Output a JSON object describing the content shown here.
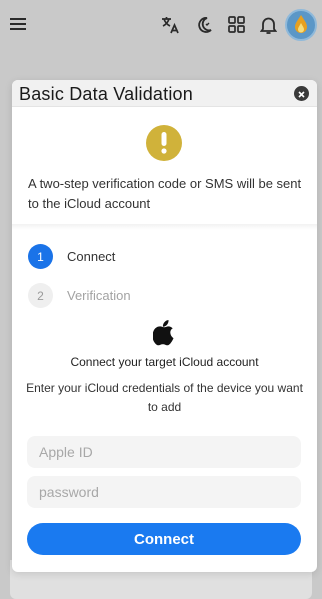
{
  "topbar": {
    "icons": [
      "menu-icon",
      "translate-icon",
      "dark-mode-icon",
      "apps-icon",
      "bell-icon",
      "avatar"
    ]
  },
  "modal": {
    "title": "Basic Data Validation",
    "notice": "A two-step verification code or SMS will be sent to the iCloud account",
    "steps": [
      {
        "number": "1",
        "label": "Connect",
        "state": "active"
      },
      {
        "number": "2",
        "label": "Verification",
        "state": "inactive"
      }
    ],
    "connect_title": "Connect your target iCloud account",
    "connect_desc": "Enter your iCloud credentials of the device you want to add",
    "fields": {
      "apple_id_placeholder": "Apple ID",
      "password_placeholder": "password"
    },
    "connect_button": "Connect"
  },
  "colors": {
    "accent": "#1a7af0",
    "warning": "#d0b23a",
    "overlay": "#c9c9c9"
  }
}
